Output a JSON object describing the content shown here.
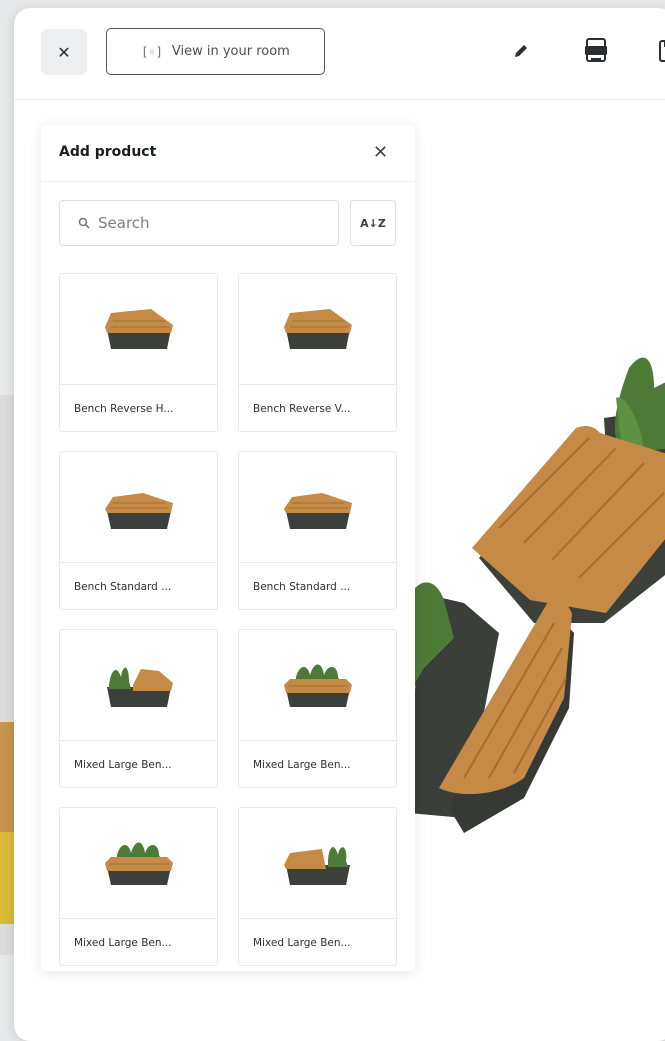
{
  "toolbar": {
    "close_icon": "close-icon",
    "view_room_label": "View in your room",
    "view_room_icon": "ar-scan-icon",
    "tools": [
      "pencil-icon",
      "pdf-icon",
      "save-icon"
    ]
  },
  "panel": {
    "title": "Add product",
    "close_icon": "close-icon",
    "search_placeholder": "Search",
    "sort_label": "A↓Z"
  },
  "products": [
    {
      "label": "Bench Reverse H...",
      "kind": "bench-reverse"
    },
    {
      "label": "Bench Reverse V...",
      "kind": "bench-reverse"
    },
    {
      "label": "Bench Standard ...",
      "kind": "bench-standard"
    },
    {
      "label": "Bench Standard ...",
      "kind": "bench-standard"
    },
    {
      "label": "Mixed Large Ben...",
      "kind": "mixed-left"
    },
    {
      "label": "Mixed Large Ben...",
      "kind": "mixed-back"
    },
    {
      "label": "Mixed Large Ben...",
      "kind": "mixed-back"
    },
    {
      "label": "Mixed Large Ben...",
      "kind": "mixed-right"
    }
  ],
  "colors": {
    "wood": "#c58a45",
    "wood_dark": "#a86d2f",
    "concrete": "#3b403b",
    "plant": "#4e7a38",
    "accent_wood_bg": "#c89450",
    "accent_yellow_bg": "#d9ba3b"
  }
}
